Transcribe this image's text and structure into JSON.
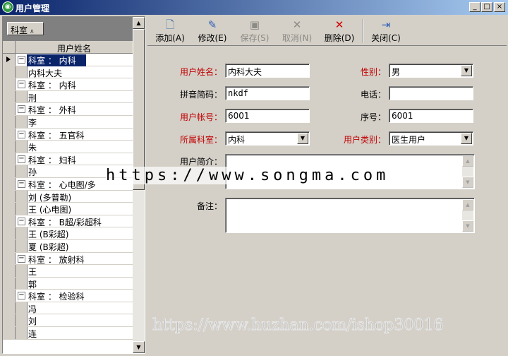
{
  "window": {
    "title": "用户管理",
    "min": "_",
    "max": "□",
    "close": "×"
  },
  "group_panel": {
    "chip_label": "科室",
    "sort_glyph": "∧"
  },
  "grid": {
    "column_header": "用户姓名",
    "rows": [
      {
        "type": "group",
        "text": "科室 ： 内科",
        "selected": true
      },
      {
        "type": "item",
        "text": "内科大夫"
      },
      {
        "type": "group",
        "text": "科室 ： 内科"
      },
      {
        "type": "item",
        "text": "刑"
      },
      {
        "type": "group",
        "text": "科室 ： 外科"
      },
      {
        "type": "item",
        "text": "李"
      },
      {
        "type": "group",
        "text": "科室 ： 五官科"
      },
      {
        "type": "item",
        "text": "朱"
      },
      {
        "type": "group",
        "text": "科室 ： 妇科"
      },
      {
        "type": "item",
        "text": "孙"
      },
      {
        "type": "group",
        "text": "科室 ： 心电图/多"
      },
      {
        "type": "item",
        "text": "刘     (多普勒)"
      },
      {
        "type": "item",
        "text": "王     (心电图)"
      },
      {
        "type": "group",
        "text": "科室 ： B超/彩超科"
      },
      {
        "type": "item",
        "text": "王     (B彩超)"
      },
      {
        "type": "item",
        "text": "夏     (B彩超)"
      },
      {
        "type": "group",
        "text": "科室 ： 放射科"
      },
      {
        "type": "item",
        "text": "王"
      },
      {
        "type": "item",
        "text": "郭"
      },
      {
        "type": "group",
        "text": "科室 ： 检验科"
      },
      {
        "type": "item",
        "text": "冯"
      },
      {
        "type": "item",
        "text": "刘"
      },
      {
        "type": "item",
        "text": "连"
      }
    ]
  },
  "toolbar": {
    "add": "添加(A)",
    "edit": "修改(E)",
    "save": "保存(S)",
    "cancel": "取消(N)",
    "delete": "删除(D)",
    "close": "关闭(C)"
  },
  "form": {
    "name_label": "用户姓名：",
    "name_value": "内科大夫",
    "gender_label": "性别：",
    "gender_value": "男",
    "pinyin_label": "拼音简码：",
    "pinyin_value": "nkdf",
    "phone_label": "电话：",
    "phone_value": "",
    "account_label": "用户帐号：",
    "account_value": "6001",
    "seq_label": "序号：",
    "seq_value": "6001",
    "dept_label": "所属科室：",
    "dept_value": "内科",
    "type_label": "用户类别：",
    "type_value": "医生用户",
    "intro_label": "用户简介：",
    "notes_label": "备注："
  },
  "watermarks": {
    "top": "https://www.songma.com",
    "bottom": "https://www.huzhan.com/ishop30016"
  },
  "colors": {
    "required_label": "#c00000",
    "selection": "#0a246a",
    "title_gradient_start": "#0a246a"
  }
}
